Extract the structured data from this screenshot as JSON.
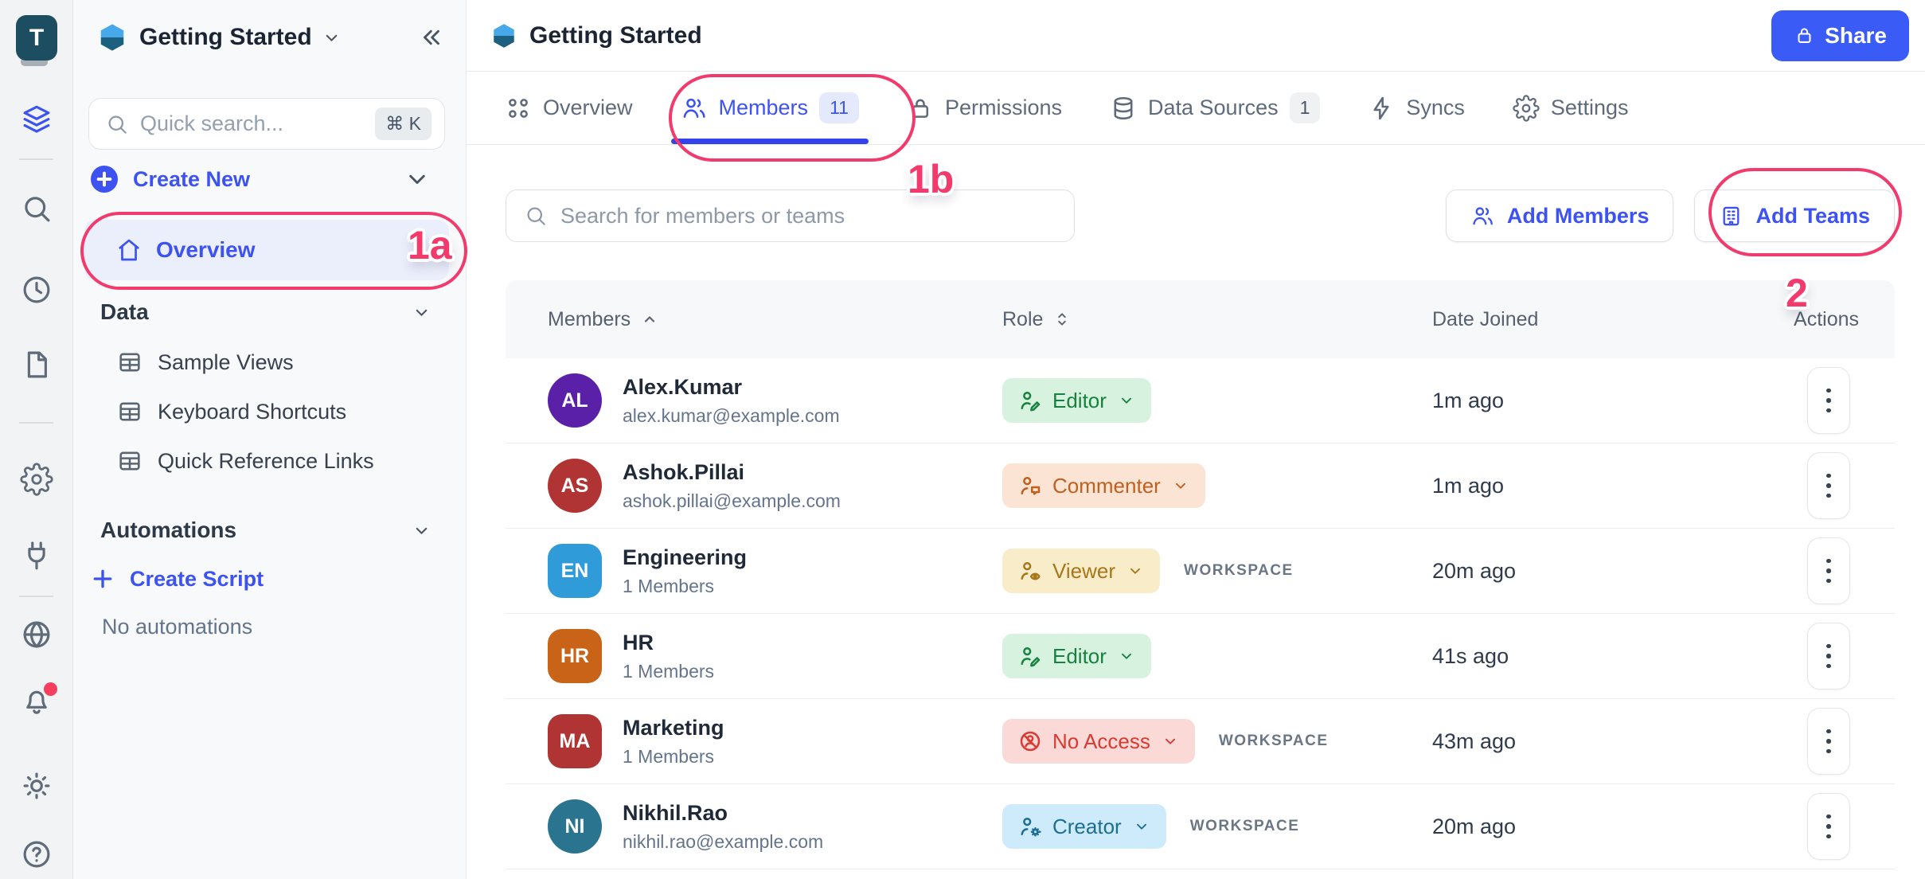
{
  "colors": {
    "accent": "#3D53F1",
    "underline": "#3443E9",
    "annotation": "#F23A6C",
    "share_bg": "#3B5BF7"
  },
  "rail": {
    "avatar_letter": "T",
    "items": [
      {
        "icon": "layers-icon",
        "active": true
      },
      {
        "icon": "divider"
      },
      {
        "icon": "search-icon"
      },
      {
        "icon": "history-icon"
      },
      {
        "icon": "document-icon"
      },
      {
        "icon": "divider"
      },
      {
        "icon": "settings-icon"
      },
      {
        "icon": "plug-icon"
      },
      {
        "icon": "divider"
      },
      {
        "icon": "globe-icon"
      },
      {
        "icon": "notifications-icon",
        "dot": true
      },
      {
        "icon": "theme-icon"
      },
      {
        "icon": "help-icon"
      }
    ]
  },
  "sidebar": {
    "workspace_name": "Getting Started",
    "search": {
      "placeholder": "Quick search...",
      "shortcut": "⌘ K"
    },
    "create_new": "Create New",
    "overview": "Overview",
    "data_section": {
      "label": "Data",
      "items": [
        "Sample Views",
        "Keyboard Shortcuts",
        "Quick Reference Links"
      ]
    },
    "automations_section": {
      "label": "Automations",
      "create_script": "Create Script",
      "empty": "No automations"
    }
  },
  "header": {
    "title": "Getting Started",
    "share": "Share"
  },
  "tabs": [
    {
      "label": "Overview",
      "icon": "grid-icon"
    },
    {
      "label": "Members",
      "icon": "people-icon",
      "badge": "11",
      "active": true
    },
    {
      "label": "Permissions",
      "icon": "lock-icon"
    },
    {
      "label": "Data Sources",
      "icon": "database-icon",
      "badge": "1"
    },
    {
      "label": "Syncs",
      "icon": "bolt-icon"
    },
    {
      "label": "Settings",
      "icon": "gear-icon"
    }
  ],
  "toolbar": {
    "search_placeholder": "Search for members or teams",
    "add_members": "Add Members",
    "add_teams": "Add Teams"
  },
  "table": {
    "headers": {
      "members": "Members",
      "role": "Role",
      "date": "Date Joined",
      "actions": "Actions"
    },
    "workspace_tag": "WORKSPACE",
    "role_styles": {
      "editor": {
        "bg": "#D7F3DF",
        "fg": "#17813F"
      },
      "commenter": {
        "bg": "#FBE4D4",
        "fg": "#C05F1E"
      },
      "viewer": {
        "bg": "#F9ECC8",
        "fg": "#A8761A"
      },
      "no_access": {
        "bg": "#FAD9D7",
        "fg": "#D93A31"
      },
      "creator": {
        "bg": "#CDEBFA",
        "fg": "#1D6E93"
      }
    },
    "rows": [
      {
        "initials": "AL",
        "avatar_color": "#5A21A8",
        "shape": "circle",
        "name": "Alex.Kumar",
        "sub": "alex.kumar@example.com",
        "role": "Editor",
        "role_key": "editor",
        "workspace": false,
        "date": "1m ago"
      },
      {
        "initials": "AS",
        "avatar_color": "#B13434",
        "shape": "circle",
        "name": "Ashok.Pillai",
        "sub": "ashok.pillai@example.com",
        "role": "Commenter",
        "role_key": "commenter",
        "workspace": false,
        "date": "1m ago"
      },
      {
        "initials": "EN",
        "avatar_color": "#2F9CD9",
        "shape": "rounded",
        "name": "Engineering",
        "sub": "1 Members",
        "role": "Viewer",
        "role_key": "viewer",
        "workspace": true,
        "date": "20m ago"
      },
      {
        "initials": "HR",
        "avatar_color": "#C96318",
        "shape": "rounded",
        "name": "HR",
        "sub": "1 Members",
        "role": "Editor",
        "role_key": "editor",
        "workspace": false,
        "date": "41s ago"
      },
      {
        "initials": "MA",
        "avatar_color": "#B13434",
        "shape": "rounded",
        "name": "Marketing",
        "sub": "1 Members",
        "role": "No Access",
        "role_key": "no_access",
        "workspace": true,
        "date": "43m ago"
      },
      {
        "initials": "NI",
        "avatar_color": "#2A7490",
        "shape": "circle",
        "name": "Nikhil.Rao",
        "sub": "nikhil.rao@example.com",
        "role": "Creator",
        "role_key": "creator",
        "workspace": true,
        "date": "20m ago"
      }
    ]
  },
  "annotations": {
    "a": "1a",
    "b": "1b",
    "c": "2"
  }
}
